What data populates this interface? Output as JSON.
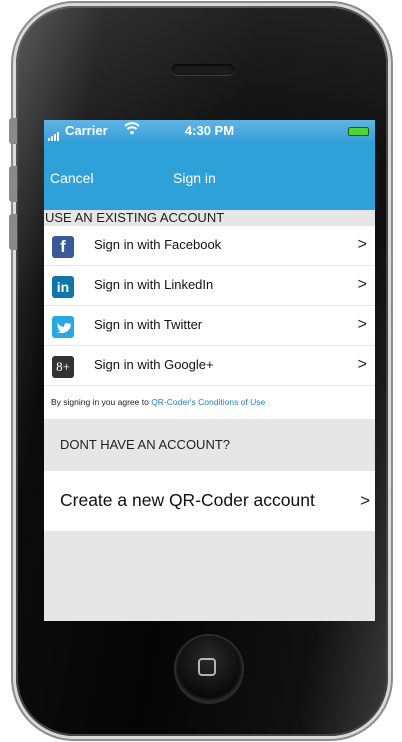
{
  "status_bar": {
    "carrier": "Carrier",
    "wifi_icon": "wifi-icon",
    "time": "4:30 PM",
    "battery_color": "#4cd535"
  },
  "nav_bar": {
    "left_button": "Cancel",
    "title": "Sign in",
    "color": "#2ea1d8"
  },
  "existing_account": {
    "header": "USE AN EXISTING ACCOUNT",
    "providers": [
      {
        "label": "Sign in with Facebook",
        "icon": "facebook-icon",
        "glyph": "f",
        "color": "#3b5998"
      },
      {
        "label": "Sign in with LinkedIn",
        "icon": "linkedin-icon",
        "glyph": "in",
        "color": "#0e76a8"
      },
      {
        "label": "Sign in with Twitter",
        "icon": "twitter-icon",
        "glyph": "",
        "color": "#2ba8e0"
      },
      {
        "label": "Sign in with Google+",
        "icon": "google-plus-icon",
        "glyph": "8+",
        "color": "#333333"
      }
    ],
    "chevron": ">"
  },
  "terms": {
    "prefix": "By signing in you agree to",
    "link": "QR-Coder's Conditions of Use"
  },
  "new_account": {
    "header": "DONT HAVE AN ACCOUNT?",
    "create_label": "Create a new QR-Coder account",
    "chevron": ">"
  }
}
